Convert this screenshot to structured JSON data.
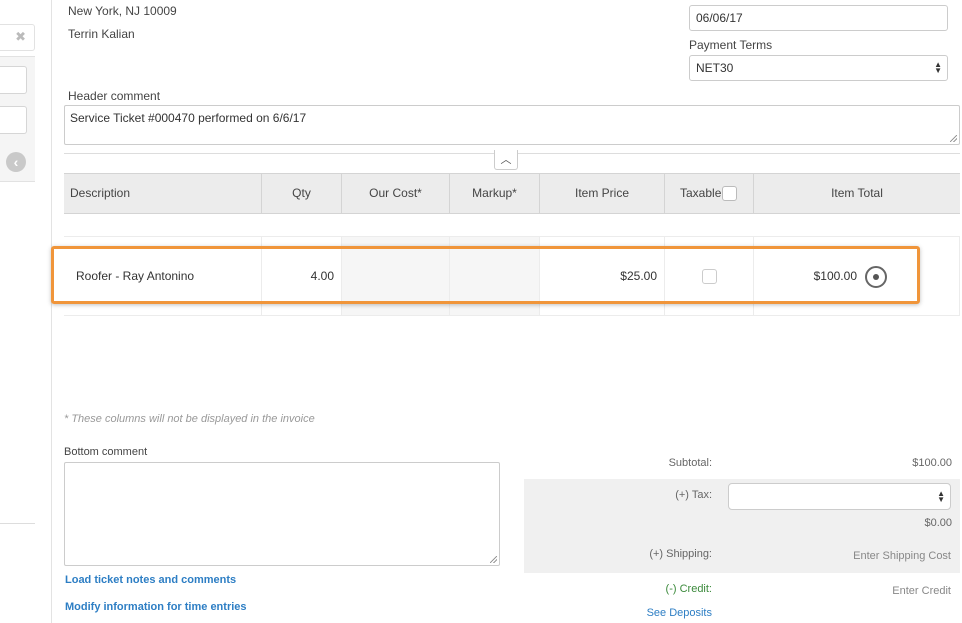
{
  "address": {
    "city_line": "New York, NJ 10009",
    "contact": "Terrin Kalian"
  },
  "date_field": {
    "value": "06/06/17"
  },
  "payment_terms": {
    "label": "Payment Terms",
    "value": "NET30"
  },
  "header_comment": {
    "label": "Header comment",
    "value": "Service Ticket #000470 performed on 6/6/17"
  },
  "table": {
    "columns": [
      "Description",
      "Qty",
      "Our Cost*",
      "Markup*",
      "Item Price",
      "Taxable",
      "Item Total"
    ],
    "rows": [
      {
        "description": "Roofer - Ray Antonino",
        "qty": "4.00",
        "our_cost": "",
        "markup": "",
        "item_price": "$25.00",
        "taxable": false,
        "item_total": "$100.00"
      }
    ]
  },
  "footnote": "* These columns will not be displayed in the invoice",
  "bottom_comment": {
    "label": "Bottom comment",
    "value": ""
  },
  "links": {
    "load_notes": "Load ticket notes and comments",
    "modify_time": "Modify information for time entries"
  },
  "totals": {
    "subtotal_label": "Subtotal:",
    "subtotal_value": "$100.00",
    "tax_label": "(+) Tax:",
    "tax_value": "$0.00",
    "shipping_label": "(+) Shipping:",
    "shipping_placeholder": "Enter Shipping Cost",
    "credit_label": "(-) Credit:",
    "credit_placeholder": "Enter Credit",
    "see_deposits": "See Deposits"
  },
  "icons": {
    "close": "close-icon",
    "back": "back-arrow-icon",
    "collapse": "chevron-up-icon",
    "row_action": "radio-target-icon"
  },
  "colors": {
    "highlight": "#f0953a",
    "link": "#2d7ec4",
    "credit": "#3c8a3c"
  }
}
